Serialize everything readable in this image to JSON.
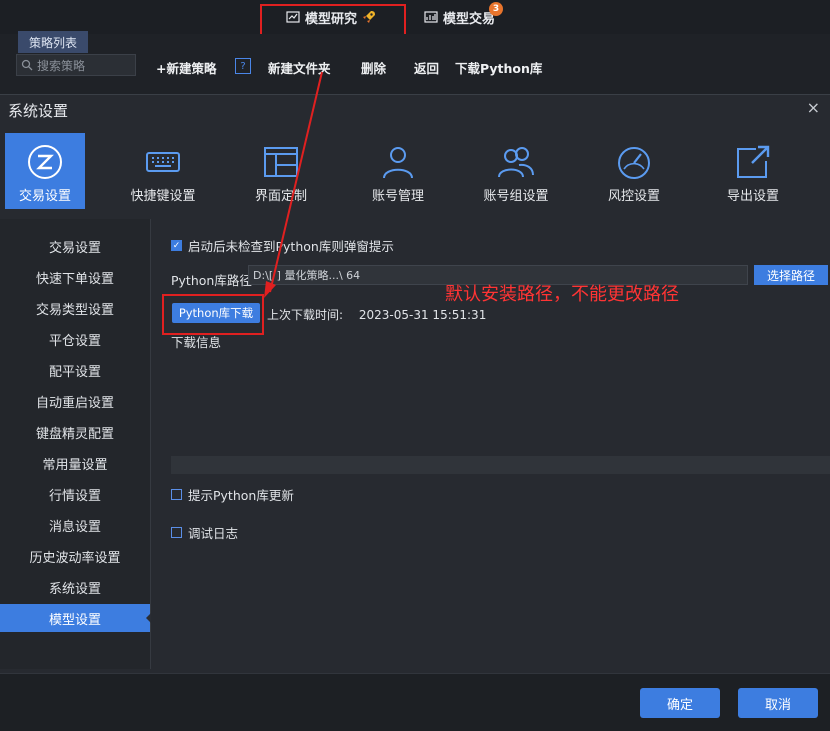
{
  "top_tabs": {
    "research": "模型研究",
    "trade": "模型交易",
    "trade_badge": "3"
  },
  "strategy": {
    "tab": "策略列表",
    "search_placeholder": "搜索策略",
    "new_strategy": "+新建策略",
    "help": "?",
    "new_folder": "新建文件夹",
    "delete": "删除",
    "back": "返回",
    "download_lib": "下载Python库"
  },
  "modal": {
    "title": "系统设置",
    "close": "×",
    "categories": [
      {
        "label": "交易设置",
        "icon": "trade-settings-icon"
      },
      {
        "label": "快捷键设置",
        "icon": "keyboard-icon"
      },
      {
        "label": "界面定制",
        "icon": "layout-icon"
      },
      {
        "label": "账号管理",
        "icon": "user-icon"
      },
      {
        "label": "账号组设置",
        "icon": "users-icon"
      },
      {
        "label": "风控设置",
        "icon": "gauge-icon"
      },
      {
        "label": "导出设置",
        "icon": "export-icon"
      }
    ],
    "sidebar": [
      "交易设置",
      "快速下单设置",
      "交易类型设置",
      "平仓设置",
      "配平设置",
      "自动重启设置",
      "键盘精灵配置",
      "常用量设置",
      "行情设置",
      "消息设置",
      "历史波动率设置",
      "系统设置",
      "模型设置"
    ],
    "content": {
      "check_popup": "启动后未检查到Python库则弹窗提示",
      "path_label": "Python库路径",
      "path_value": "D:\\[          ] 量化策略...\\ 64",
      "choose_path": "选择路径",
      "download_button": "Python库下载",
      "last_download_label": "上次下载时间:",
      "last_download_time": "2023-05-31 15:51:31",
      "download_info": "下载信息",
      "prompt_update": "提示Python库更新",
      "debug_log": "调试日志"
    },
    "annotation": "默认安装路径，不能更改路径",
    "confirm": "确定",
    "cancel": "取消"
  },
  "colors": {
    "accent": "#3d7de0",
    "callout": "#e02020"
  }
}
